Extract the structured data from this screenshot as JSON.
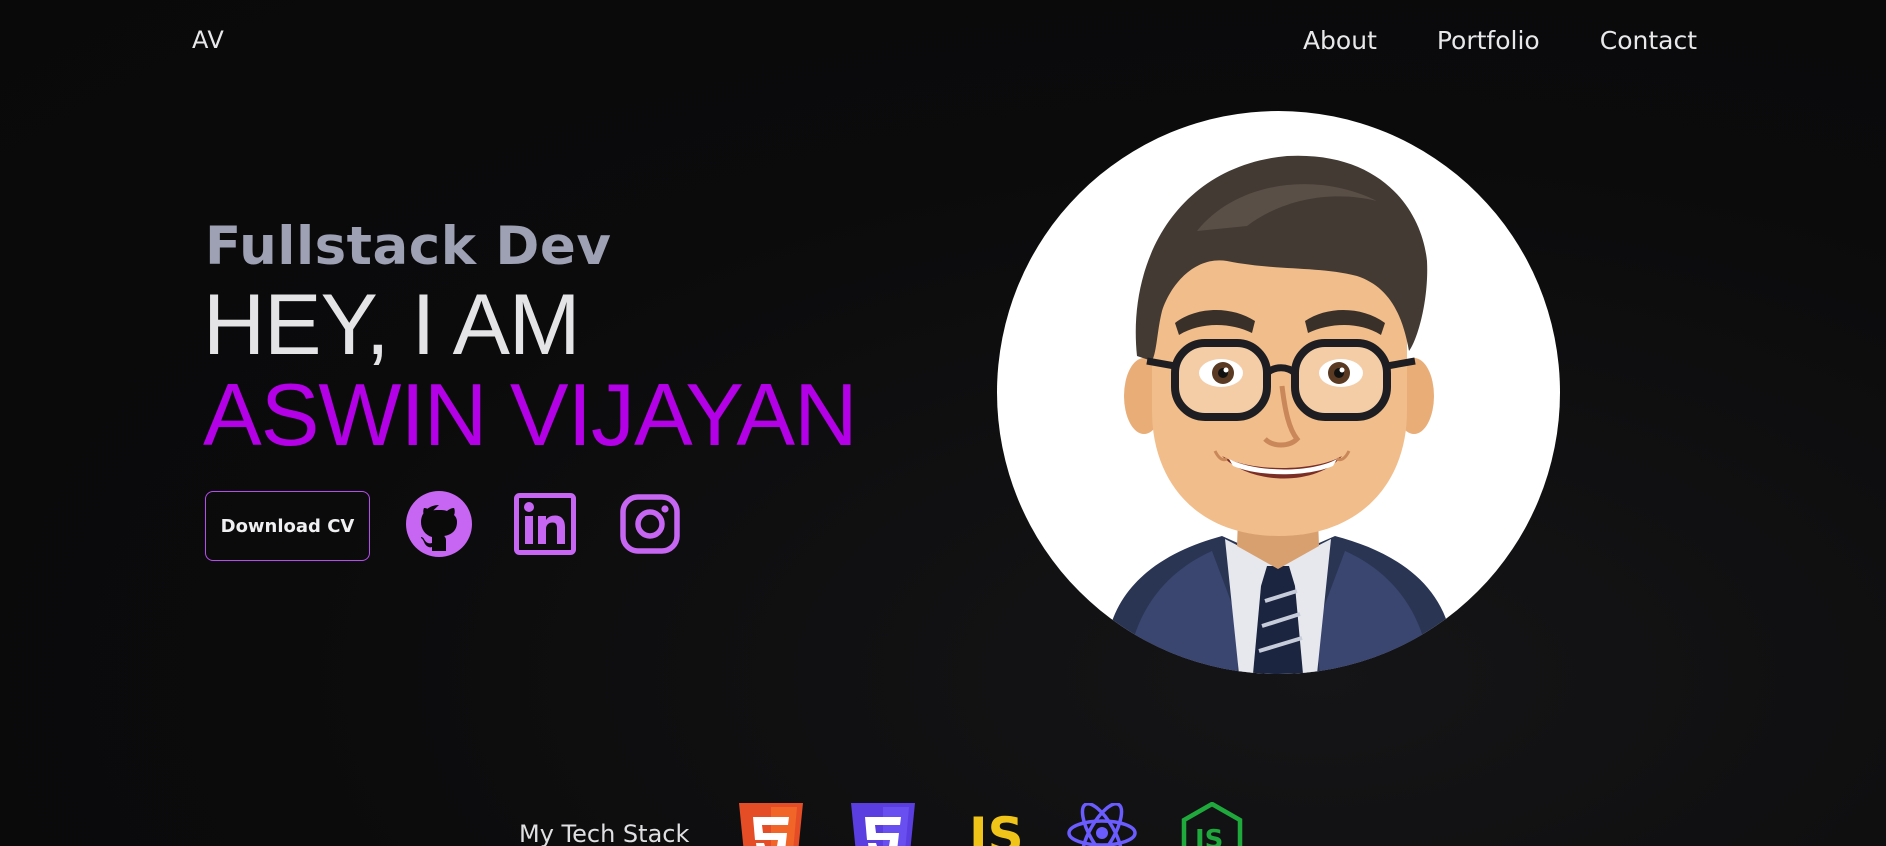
{
  "nav": {
    "logo": "AV",
    "links": [
      "About",
      "Portfolio",
      "Contact"
    ]
  },
  "hero": {
    "subtitle": "Fullstack Dev",
    "greeting": "HEY, I AM",
    "name": "ASWIN VIJAYAN",
    "cv_button": "Download CV"
  },
  "social": [
    {
      "icon": "github-icon"
    },
    {
      "icon": "linkedin-icon"
    },
    {
      "icon": "instagram-icon"
    }
  ],
  "avatar": {
    "icon": "avatar-illustration"
  },
  "tech_stack": {
    "label": "My Tech Stack",
    "icons": [
      "html5-icon",
      "css3-icon",
      "javascript-icon",
      "react-icon",
      "nodejs-icon"
    ]
  },
  "colors": {
    "accent": "#b300e6",
    "social_icon": "#c666f2",
    "subtitle": "#9ea1b3",
    "background": "#0a0a0b"
  }
}
